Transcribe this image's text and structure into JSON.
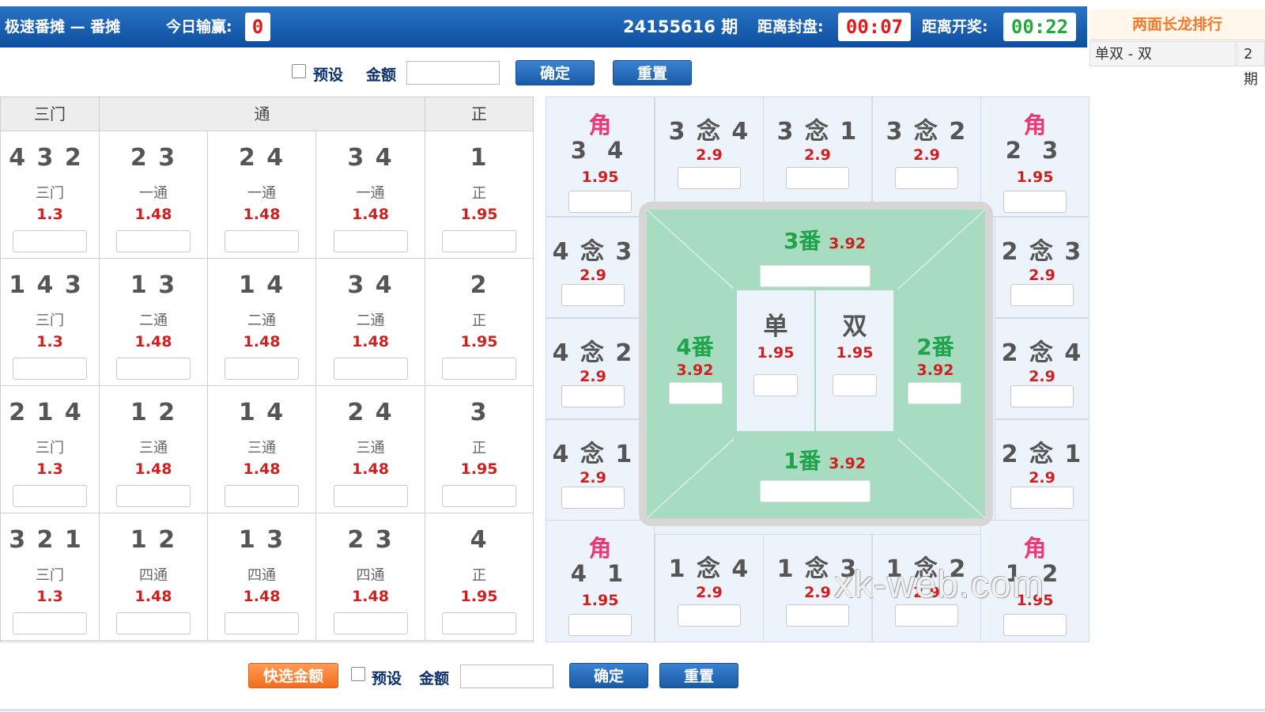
{
  "header": {
    "title": "极速番摊 — 番摊",
    "today_label": "今日输赢:",
    "today_value": "0",
    "period": "24155616 期",
    "close_label": "距离封盘:",
    "close_time": "00:07",
    "open_label": "距离开奖:",
    "open_time": "00:22"
  },
  "ranking": {
    "title": "两面长龙排行",
    "row_label": "单双 - 双",
    "row_value": "2 期"
  },
  "top_controls": {
    "preset_label": "预设",
    "amount_label": "金额",
    "confirm": "确定",
    "reset": "重置"
  },
  "bottom_controls": {
    "quick": "快选金额",
    "preset_label": "预设",
    "amount_label": "金额",
    "confirm": "确定",
    "reset": "重置"
  },
  "left_grid": {
    "headers": [
      "三门",
      "通",
      "正"
    ],
    "rows": [
      [
        {
          "nums": "4 3 2",
          "sub": "三门",
          "odds": "1.3"
        },
        {
          "nums": "2 3",
          "sub": "一通",
          "odds": "1.48"
        },
        {
          "nums": "2 4",
          "sub": "一通",
          "odds": "1.48"
        },
        {
          "nums": "3 4",
          "sub": "一通",
          "odds": "1.48"
        },
        {
          "nums": "1",
          "sub": "正",
          "odds": "1.95"
        }
      ],
      [
        {
          "nums": "1 4 3",
          "sub": "三门",
          "odds": "1.3"
        },
        {
          "nums": "1 3",
          "sub": "二通",
          "odds": "1.48"
        },
        {
          "nums": "1 4",
          "sub": "二通",
          "odds": "1.48"
        },
        {
          "nums": "3 4",
          "sub": "二通",
          "odds": "1.48"
        },
        {
          "nums": "2",
          "sub": "正",
          "odds": "1.95"
        }
      ],
      [
        {
          "nums": "2 1 4",
          "sub": "三门",
          "odds": "1.3"
        },
        {
          "nums": "1 2",
          "sub": "三通",
          "odds": "1.48"
        },
        {
          "nums": "1 4",
          "sub": "三通",
          "odds": "1.48"
        },
        {
          "nums": "2 4",
          "sub": "三通",
          "odds": "1.48"
        },
        {
          "nums": "3",
          "sub": "正",
          "odds": "1.95"
        }
      ],
      [
        {
          "nums": "3 2 1",
          "sub": "三门",
          "odds": "1.3"
        },
        {
          "nums": "1 2",
          "sub": "四通",
          "odds": "1.48"
        },
        {
          "nums": "1 3",
          "sub": "四通",
          "odds": "1.48"
        },
        {
          "nums": "2 3",
          "sub": "四通",
          "odds": "1.48"
        },
        {
          "nums": "4",
          "sub": "正",
          "odds": "1.95"
        }
      ]
    ]
  },
  "board": {
    "corner_label": "角",
    "corners": {
      "tl": {
        "nums": "3 4",
        "odds": "1.95"
      },
      "tr": {
        "nums": "2 3",
        "odds": "1.95"
      },
      "bl": {
        "nums": "4 1",
        "odds": "1.95"
      },
      "br": {
        "nums": "1 2",
        "odds": "1.95"
      }
    },
    "top": [
      {
        "label": "3 念 4",
        "odds": "2.9"
      },
      {
        "label": "3 念 1",
        "odds": "2.9"
      },
      {
        "label": "3 念 2",
        "odds": "2.9"
      }
    ],
    "bottom": [
      {
        "label": "1 念 4",
        "odds": "2.9"
      },
      {
        "label": "1 念 3",
        "odds": "2.9"
      },
      {
        "label": "1 念 2",
        "odds": "2.9"
      }
    ],
    "left": [
      {
        "label": "4 念 3",
        "odds": "2.9"
      },
      {
        "label": "4 念 2",
        "odds": "2.9"
      },
      {
        "label": "4 念 1",
        "odds": "2.9"
      }
    ],
    "right": [
      {
        "label": "2 念 3",
        "odds": "2.9"
      },
      {
        "label": "2 念 4",
        "odds": "2.9"
      },
      {
        "label": "2 念 1",
        "odds": "2.9"
      }
    ],
    "fan3": {
      "label": "3番",
      "odds": "3.92"
    },
    "fan1": {
      "label": "1番",
      "odds": "3.92"
    },
    "fan4": {
      "label": "4番",
      "odds": "3.92"
    },
    "fan2": {
      "label": "2番",
      "odds": "3.92"
    },
    "single": {
      "label": "单",
      "odds": "1.95"
    },
    "double": {
      "label": "双",
      "odds": "1.95"
    }
  },
  "watermark": "xk-web.com"
}
